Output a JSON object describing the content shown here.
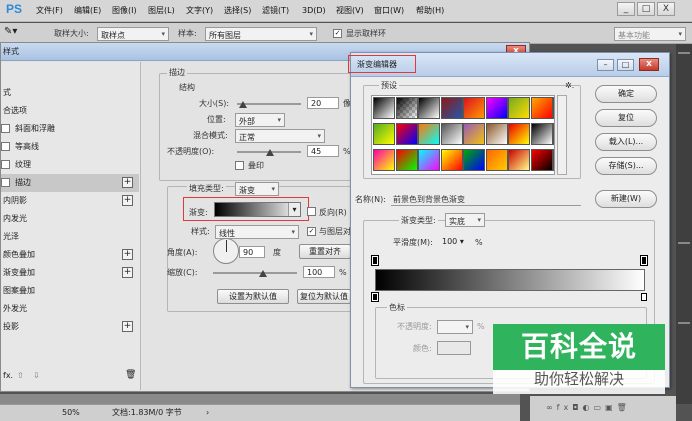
{
  "app": {
    "logo": "PS",
    "workspace": "基本功能"
  },
  "menu": [
    "文件(F)",
    "编辑(E)",
    "图像(I)",
    "图层(L)",
    "文字(Y)",
    "选择(S)",
    "滤镜(T)",
    "3D(D)",
    "视图(V)",
    "窗口(W)",
    "帮助(H)"
  ],
  "window_controls": {
    "minimize": "_",
    "maximize": "□",
    "close": "X"
  },
  "options_bar": {
    "sample_size_label": "取样大小:",
    "sample_size_value": "取样点",
    "sample_label": "样本:",
    "sample_value": "所有图层",
    "show_ring_label": "显示取样环",
    "show_ring_checked": "✓"
  },
  "layer_style": {
    "title": "样式",
    "close": "x",
    "left_items": [
      {
        "label": "式",
        "has_check": false,
        "has_plus": false,
        "selected": false
      },
      {
        "label": "合选项",
        "has_check": false,
        "has_plus": false,
        "selected": false
      },
      {
        "label": "斜面和浮雕",
        "has_check": true,
        "has_plus": false,
        "selected": false
      },
      {
        "label": "等高线",
        "has_check": true,
        "has_plus": false,
        "selected": false
      },
      {
        "label": "纹理",
        "has_check": true,
        "has_plus": false,
        "selected": false
      },
      {
        "label": "描边",
        "has_check": true,
        "has_plus": true,
        "selected": true
      },
      {
        "label": "内阴影",
        "has_check": false,
        "has_plus": true,
        "selected": false
      },
      {
        "label": "内发光",
        "has_check": false,
        "has_plus": false,
        "selected": false
      },
      {
        "label": "光泽",
        "has_check": false,
        "has_plus": false,
        "selected": false
      },
      {
        "label": "颜色叠加",
        "has_check": false,
        "has_plus": true,
        "selected": false
      },
      {
        "label": "渐变叠加",
        "has_check": false,
        "has_plus": true,
        "selected": false
      },
      {
        "label": "图案叠加",
        "has_check": false,
        "has_plus": false,
        "selected": false
      },
      {
        "label": "外发光",
        "has_check": false,
        "has_plus": false,
        "selected": false
      },
      {
        "label": "投影",
        "has_check": false,
        "has_plus": true,
        "selected": false
      }
    ],
    "bottom_icons": {
      "fx": "fx.",
      "up": "⇧",
      "down": "⇩",
      "trash": "🗑"
    },
    "stroke": {
      "section": "描边",
      "structure": "结构",
      "size_label": "大小(S):",
      "size_value": "20",
      "size_unit": "像素",
      "position_label": "位置:",
      "position_value": "外部",
      "blend_label": "混合模式:",
      "blend_value": "正常",
      "opacity_label": "不透明度(O):",
      "opacity_value": "45",
      "opacity_unit": "%",
      "overprint_label": "叠印",
      "fill_type_label": "填充类型:",
      "fill_type_value": "渐变",
      "gradient_label": "渐变:",
      "reverse_label": "反向(R)",
      "style_label": "样式:",
      "style_value": "线性",
      "align_label": "与图层对",
      "angle_label": "角度(A):",
      "angle_value": "90",
      "angle_unit": "度",
      "reset_align": "重置对齐",
      "scale_label": "缩放(C):",
      "scale_value": "100",
      "scale_unit": "%",
      "set_default": "设置为默认值",
      "reset_default": "复位为默认值"
    }
  },
  "gradient_editor": {
    "title": "渐变编辑器",
    "presets_label": "预设",
    "gear": "✲.",
    "ok": "确定",
    "reset": "复位",
    "load": "载入(L)...",
    "save": "存储(S)...",
    "name_label": "名称(N):",
    "name_value": "前景色到背景色渐变",
    "new_button": "新建(W)",
    "type_label": "渐变类型:",
    "type_value": "实底",
    "smooth_label": "平滑度(M):",
    "smooth_value": "100",
    "smooth_unit": "%",
    "color_stops_label": "色标",
    "opacity_label": "不透明度:",
    "opacity_unit": "%",
    "color_label": "颜色:",
    "preset_colors": [
      [
        "#000000",
        "#ffffff"
      ],
      [
        "#000000",
        "transparent"
      ],
      [
        "#000000",
        "#ffffff"
      ],
      [
        "#8b1a1a",
        "#2457a8"
      ],
      [
        "#d12",
        "#f90"
      ],
      [
        "#f0f",
        "#00f"
      ],
      [
        "#7a2",
        "#fd0"
      ],
      [
        "#fa0",
        "#f00"
      ],
      [
        "#444",
        "#ccc"
      ],
      [
        "#5a2",
        "#ff0"
      ],
      [
        "#f00",
        "#00f"
      ],
      [
        "#f70",
        "#0ff"
      ],
      [
        "#555",
        "#fff"
      ],
      [
        "#9b59b6",
        "#f1c40f"
      ],
      [
        "#8b5a2b",
        "#ffffff"
      ],
      [
        "#e00",
        "#ff0"
      ],
      [
        "#000",
        "#fff"
      ],
      [
        "#cccccc",
        "#ffffff"
      ],
      [
        "#f0a",
        "#ff0"
      ],
      [
        "#f00",
        "#0f0"
      ],
      [
        "#0ff",
        "#f0f"
      ],
      [
        "#ff0",
        "#f00"
      ],
      [
        "#0a0",
        "#00f"
      ],
      [
        "#f60",
        "#fc0"
      ],
      [
        "#c00",
        "#ff8"
      ],
      [
        "#f00",
        "#000"
      ],
      [
        "#ddd",
        "#888"
      ]
    ]
  },
  "watermark": {
    "main": "百科全说",
    "sub": "助你轻松解决"
  },
  "status": {
    "zoom": "50%",
    "doc": "文档:1.83M/0 字节",
    "arrow": "›"
  }
}
